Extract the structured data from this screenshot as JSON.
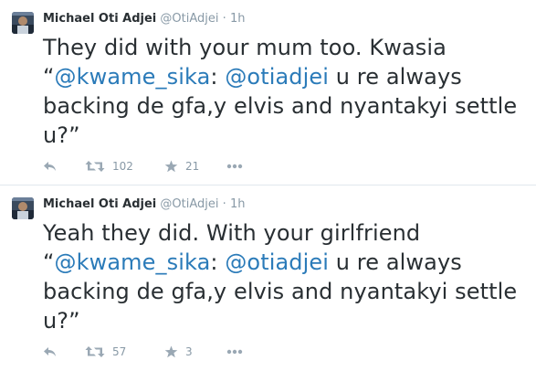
{
  "tweets": [
    {
      "name": "Michael Oti Adjei",
      "handle": "@OtiAdjei",
      "separator": "·",
      "time": "1h",
      "text_pre": "They did with your mum too. Kwasia “",
      "mention1": "@kwame_sika",
      "text_mid": ": ",
      "mention2": "@otiadjei",
      "text_post": " u re always backing de gfa,y elvis and nyantakyi settle u?”",
      "retweets": "102",
      "favorites": "21"
    },
    {
      "name": "Michael Oti Adjei",
      "handle": "@OtiAdjei",
      "separator": "·",
      "time": "1h",
      "text_pre": "Yeah they did. With your girlfriend “",
      "mention1": "@kwame_sika",
      "text_mid": ": ",
      "mention2": "@otiadjei",
      "text_post": " u re always backing de gfa,y elvis and nyantakyi settle u?”",
      "retweets": "57",
      "favorites": "3"
    }
  ],
  "icons": {
    "reply": "reply-icon",
    "retweet": "retweet-icon",
    "favorite": "star-icon",
    "more": "more-icon"
  },
  "colors": {
    "link": "#2b7bb9",
    "meta": "#8899a6",
    "text": "#292f33"
  }
}
